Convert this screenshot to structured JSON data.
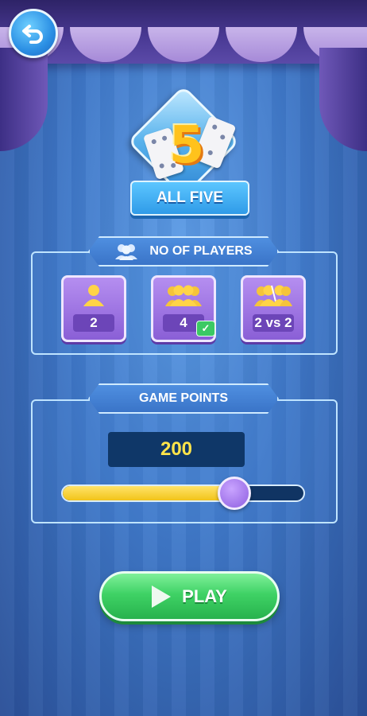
{
  "game": {
    "logo_number": "5",
    "title": "ALL FIVE"
  },
  "players": {
    "header": "NO OF PLAYERS",
    "options": [
      {
        "label": "2",
        "icon": "single-player-icon",
        "selected": false
      },
      {
        "label": "4",
        "icon": "group-players-icon",
        "selected": true
      },
      {
        "label": "2 vs 2",
        "icon": "team-vs-icon",
        "selected": false
      }
    ]
  },
  "points": {
    "header": "GAME POINTS",
    "value": "200",
    "slider_fraction": 0.71
  },
  "play": {
    "label": "PLAY"
  },
  "colors": {
    "accent_green": "#3fd265",
    "accent_purple": "#8a5fd6",
    "accent_yellow": "#ffe44a"
  }
}
